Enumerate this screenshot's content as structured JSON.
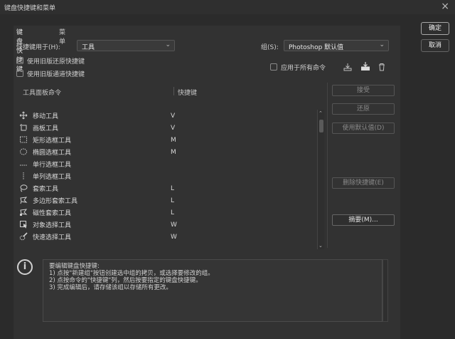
{
  "window": {
    "title": "键盘快捷键和菜单"
  },
  "tabs": [
    {
      "label": "键盘快捷键"
    },
    {
      "label": "菜单"
    }
  ],
  "shortcut_for": {
    "label": "快捷键用于(H):",
    "value": "工具"
  },
  "group": {
    "label": "组(S):",
    "value": "Photoshop 默认值"
  },
  "options": {
    "legacy_undo": "使用旧版还原快捷键",
    "legacy_channels": "使用旧版通道快捷键",
    "apply_all": "应用于所有命令"
  },
  "table": {
    "col_command": "工具面板命令",
    "col_shortcut": "快捷键",
    "rows": [
      {
        "icon": "move-icon",
        "name": "移动工具",
        "key": "V"
      },
      {
        "icon": "artboard-icon",
        "name": "画板工具",
        "key": "V"
      },
      {
        "icon": "rect-marquee-icon",
        "name": "矩形选框工具",
        "key": "M"
      },
      {
        "icon": "ellipse-marquee-icon",
        "name": "椭圆选框工具",
        "key": "M"
      },
      {
        "icon": "single-row-marquee-icon",
        "name": "单行选框工具",
        "key": ""
      },
      {
        "icon": "single-col-marquee-icon",
        "name": "单列选框工具",
        "key": ""
      },
      {
        "icon": "lasso-icon",
        "name": "套索工具",
        "key": "L"
      },
      {
        "icon": "polygon-lasso-icon",
        "name": "多边形套索工具",
        "key": "L"
      },
      {
        "icon": "magnetic-lasso-icon",
        "name": "磁性套索工具",
        "key": "L"
      },
      {
        "icon": "object-select-icon",
        "name": "对象选择工具",
        "key": "W"
      },
      {
        "icon": "quick-select-icon",
        "name": "快速选择工具",
        "key": "W"
      }
    ]
  },
  "actions": {
    "accept": "接受",
    "undo": "还原",
    "use_default": "使用默认值(D)",
    "delete_shortcut": "删除快捷键(E)",
    "summary": "摘要(M)..."
  },
  "dialog": {
    "ok": "确定",
    "cancel": "取消"
  },
  "info": {
    "text": "要编辑键盘快捷键:\n1) 点按\"新建组\"按钮创建选中组的拷贝，或选择要修改的组。\n2) 点按命令的\"快捷键\"列，然后按要指定的键盘快捷键。\n3) 完成编辑后，请存储该组以存储所有更改。"
  },
  "colors": {
    "background": "#2b2b2b",
    "panel": "#323232",
    "text": "#d4d4d4"
  }
}
